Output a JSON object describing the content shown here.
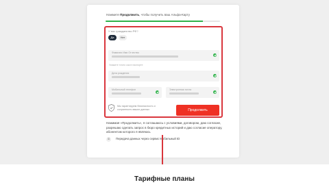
{
  "card": {
    "hint_action": "Продолжить",
    "hint_before": "Нажмите ",
    "hint_after": ", чтобы получить ваш Альфа-Карту",
    "progress": 0.85,
    "citizenship_label": "У вас гражданство РФ?",
    "option_yes": "Да",
    "option_no": "Нет",
    "fields": {
      "fio_label": "Фамилия Имя Отчество",
      "fio_hint": "Укажите точно как в паспорте",
      "birth_label": "Дата рождения",
      "phone_label": "Мобильный телефон",
      "email_label": "Электронная почта"
    },
    "security_text": "Мы гарантируем безопасность и сохранность ваших данных",
    "continue_label": "Продолжить",
    "consent_text": "Нажимая «Продолжить», я соглашаюсь с условиями, договором, даю согласие, разрешаю сделать запрос в бюро кредитных историй и даю согласие оператору, абонентом которого я являюсь",
    "transfer_icon": "ID",
    "transfer_text": "Передача данных через сервис Мобильный ID"
  },
  "section": {
    "title": "Тарифные планы"
  },
  "colors": {
    "accent": "#ef3124",
    "success": "#2fb24a",
    "highlight": "#d9353c",
    "pill_active": "#1f2b3a"
  }
}
